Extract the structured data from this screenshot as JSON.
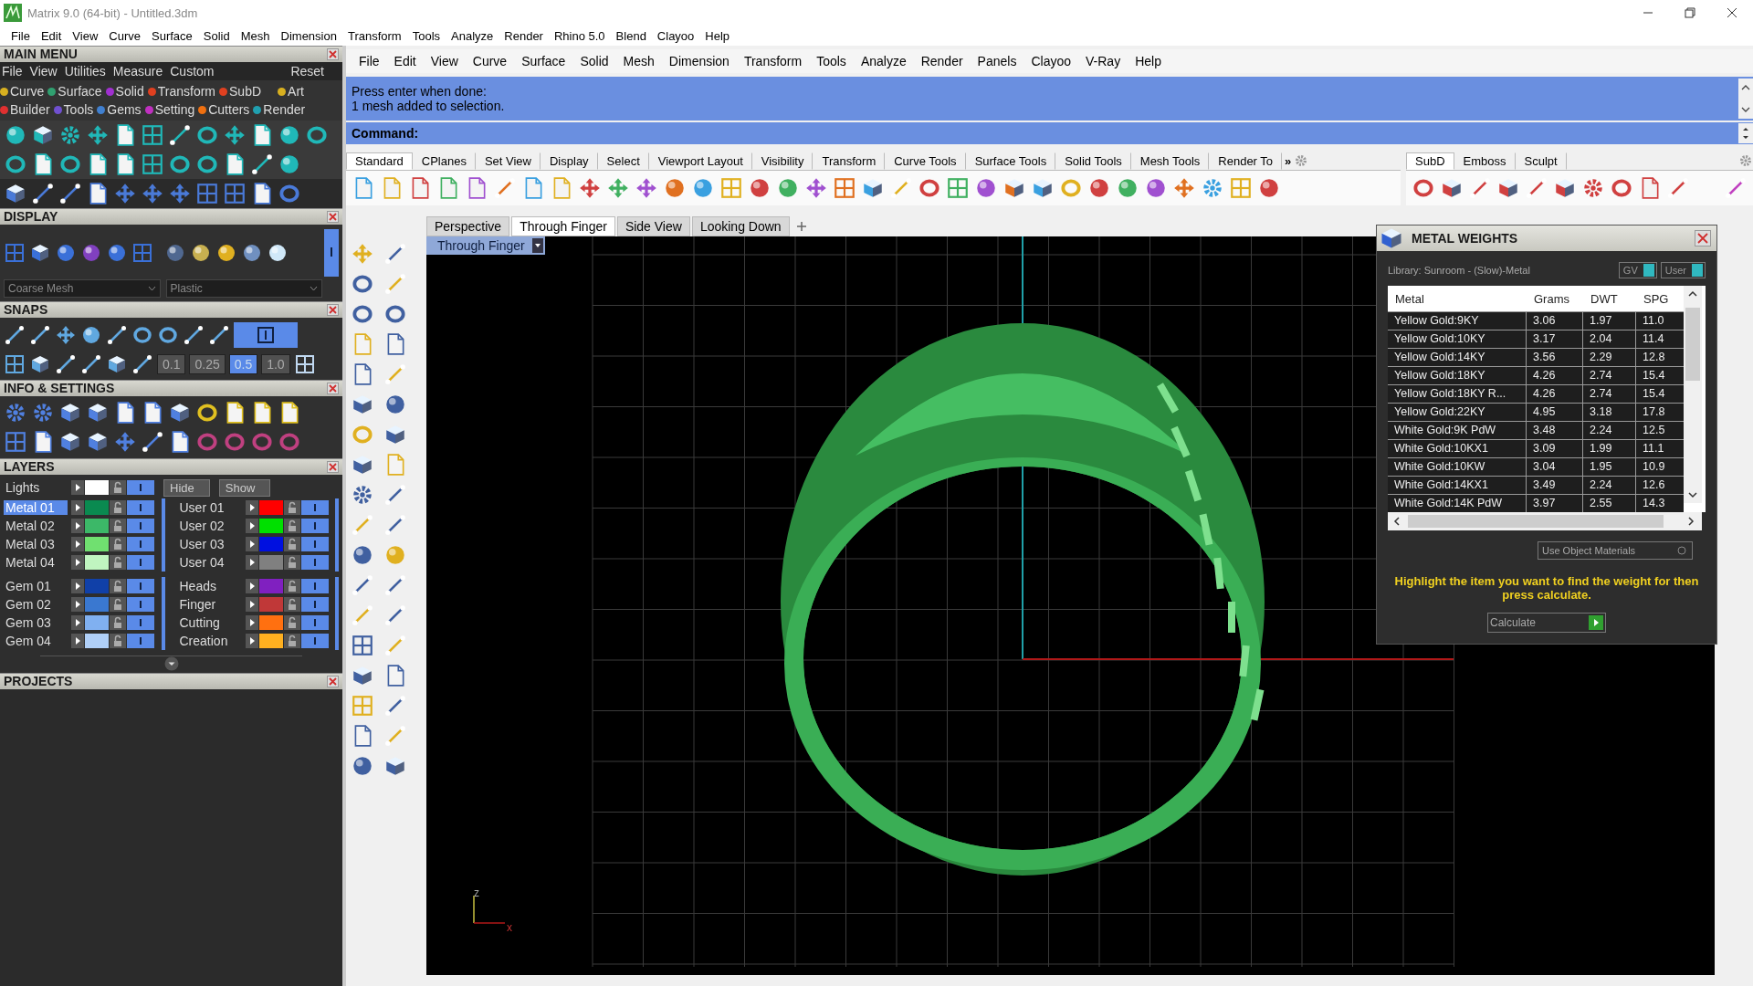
{
  "window": {
    "title": "Matrix 9.0 (64-bit) - Untitled.3dm"
  },
  "app_menu": [
    "File",
    "Edit",
    "View",
    "Curve",
    "Surface",
    "Solid",
    "Mesh",
    "Dimension",
    "Transform",
    "Tools",
    "Analyze",
    "Render",
    "Rhino 5.0",
    "Blend",
    "Clayoo",
    "Help"
  ],
  "main_menu": {
    "title": "MAIN MENU",
    "menu": [
      "File",
      "View",
      "Utilities",
      "Measure",
      "Custom"
    ],
    "reset": "Reset",
    "categories": [
      {
        "label": "Curve",
        "color": "#d8b020"
      },
      {
        "label": "Surface",
        "color": "#30a070"
      },
      {
        "label": "Solid",
        "color": "#a030d0"
      },
      {
        "label": "Transform",
        "color": "#e04020"
      },
      {
        "label": "SubD",
        "color": "#e04020"
      },
      {
        "label": "Art",
        "color": "#d8b020"
      },
      {
        "label": "Builder",
        "color": "#e03030"
      },
      {
        "label": "Tools",
        "color": "#7050d0"
      },
      {
        "label": "Gems",
        "color": "#4080d0"
      },
      {
        "label": "Setting",
        "color": "#c030c0"
      },
      {
        "label": "Cutters",
        "color": "#f07010"
      },
      {
        "label": "Render",
        "color": "#20a0b0"
      }
    ]
  },
  "display": {
    "title": "DISPLAY",
    "mesh": "Coarse Mesh",
    "material": "Plastic"
  },
  "snaps": {
    "title": "SNAPS",
    "steps": [
      {
        "label": "0.1",
        "selected": false
      },
      {
        "label": "0.25",
        "selected": false
      },
      {
        "label": "0.5",
        "selected": true
      },
      {
        "label": "1.0",
        "selected": false
      }
    ]
  },
  "info": {
    "title": "INFO & SETTINGS"
  },
  "layers": {
    "title": "LAYERS",
    "lights": {
      "name": "Lights",
      "color": "#ffffff"
    },
    "hide": "Hide",
    "show": "Show",
    "blocks": [
      [
        {
          "name": "Metal 01",
          "color": "#0a8a50",
          "selected": true
        },
        {
          "name": "Metal 02",
          "color": "#3cb868",
          "selected": false
        },
        {
          "name": "Metal 03",
          "color": "#70e070",
          "selected": false
        },
        {
          "name": "Metal 04",
          "color": "#c0f5c0",
          "selected": false
        }
      ],
      [
        {
          "name": "User 01",
          "color": "#ff0000",
          "selected": false
        },
        {
          "name": "User 02",
          "color": "#00e000",
          "selected": false
        },
        {
          "name": "User 03",
          "color": "#0010e0",
          "selected": false
        },
        {
          "name": "User 04",
          "color": "#808080",
          "selected": false
        }
      ],
      [
        {
          "name": "Gem 01",
          "color": "#1040a8",
          "selected": false
        },
        {
          "name": "Gem 02",
          "color": "#3a78d0",
          "selected": false
        },
        {
          "name": "Gem 03",
          "color": "#80b0f0",
          "selected": false
        },
        {
          "name": "Gem 04",
          "color": "#b0d0f8",
          "selected": false
        }
      ],
      [
        {
          "name": "Heads",
          "color": "#8020c0",
          "selected": false
        },
        {
          "name": "Finger",
          "color": "#c03838",
          "selected": false
        },
        {
          "name": "Cutting",
          "color": "#ff7010",
          "selected": false
        },
        {
          "name": "Creation",
          "color": "#ffb020",
          "selected": false
        }
      ]
    ]
  },
  "projects": {
    "title": "PROJECTS"
  },
  "rhino_menu": [
    "File",
    "Edit",
    "View",
    "Curve",
    "Surface",
    "Solid",
    "Mesh",
    "Dimension",
    "Transform",
    "Tools",
    "Analyze",
    "Render",
    "Panels",
    "Clayoo",
    "V-Ray",
    "Help"
  ],
  "command": {
    "history": [
      "Press enter when done:",
      "1 mesh added to selection."
    ],
    "prompt": "Command:"
  },
  "toolbar_tabs": [
    {
      "label": "Standard",
      "selected": true
    },
    {
      "label": "CPlanes",
      "selected": false
    },
    {
      "label": "Set View",
      "selected": false
    },
    {
      "label": "Display",
      "selected": false
    },
    {
      "label": "Select",
      "selected": false
    },
    {
      "label": "Viewport Layout",
      "selected": false
    },
    {
      "label": "Visibility",
      "selected": false
    },
    {
      "label": "Transform",
      "selected": false
    },
    {
      "label": "Curve Tools",
      "selected": false
    },
    {
      "label": "Surface Tools",
      "selected": false
    },
    {
      "label": "Solid Tools",
      "selected": false
    },
    {
      "label": "Mesh Tools",
      "selected": false
    },
    {
      "label": "Render To",
      "selected": false
    }
  ],
  "toolbar_more": "»",
  "right_tabs": [
    {
      "label": "SubD",
      "selected": true
    },
    {
      "label": "Emboss",
      "selected": false
    },
    {
      "label": "Sculpt",
      "selected": false
    }
  ],
  "viewport_tabs": [
    {
      "label": "Perspective",
      "selected": false
    },
    {
      "label": "Through Finger",
      "selected": true
    },
    {
      "label": "Side View",
      "selected": false
    },
    {
      "label": "Looking Down",
      "selected": false
    }
  ],
  "viewport": {
    "title": "Through Finger",
    "axis_labels": [
      "z",
      "x"
    ]
  },
  "metal_weights": {
    "title": "METAL WEIGHTS",
    "library": "Library: Sunroom - (Slow)-Metal",
    "toggles": [
      {
        "label": "GV",
        "on": true
      },
      {
        "label": "User",
        "on": true
      }
    ],
    "columns": [
      "Metal",
      "Grams",
      "DWT",
      "SPG"
    ],
    "rows": [
      [
        "Yellow Gold:9KY",
        "3.06",
        "1.97",
        "11.0"
      ],
      [
        "Yellow Gold:10KY",
        "3.17",
        "2.04",
        "11.4"
      ],
      [
        "Yellow Gold:14KY",
        "3.56",
        "2.29",
        "12.8"
      ],
      [
        "Yellow Gold:18KY",
        "4.26",
        "2.74",
        "15.4"
      ],
      [
        "Yellow Gold:18KY R...",
        "4.26",
        "2.74",
        "15.4"
      ],
      [
        "Yellow Gold:22KY",
        "4.95",
        "3.18",
        "17.8"
      ],
      [
        "White Gold:9K PdW",
        "3.48",
        "2.24",
        "12.5"
      ],
      [
        "White Gold:10KX1",
        "3.09",
        "1.99",
        "11.1"
      ],
      [
        "White Gold:10KW",
        "3.04",
        "1.95",
        "10.9"
      ],
      [
        "White Gold:14KX1",
        "3.49",
        "2.24",
        "12.6"
      ],
      [
        "White Gold:14K PdW",
        "3.97",
        "2.55",
        "14.3"
      ]
    ],
    "use_object_materials": "Use Object Materials",
    "hint": "Highlight the item you want to find the weight for then press calculate.",
    "calculate": "Calculate"
  }
}
